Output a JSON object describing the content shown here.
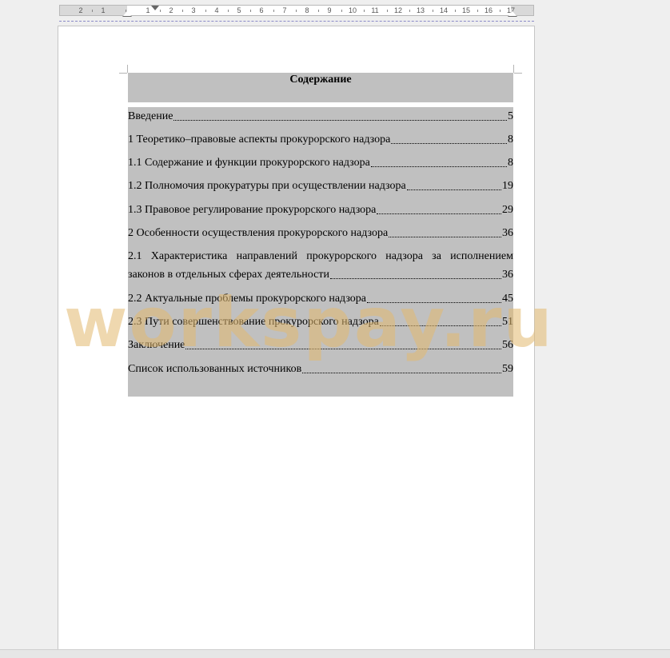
{
  "ruler": {
    "numbers": [
      "2",
      "1",
      "1",
      "2",
      "3",
      "4",
      "5",
      "6",
      "7",
      "8",
      "9",
      "10",
      "11",
      "12",
      "13",
      "14",
      "15",
      "16",
      "17"
    ]
  },
  "document": {
    "toc_title": "Содержание",
    "entries": [
      {
        "label": "Введение",
        "page": "5"
      },
      {
        "label": "1 Теоретико–правовые аспекты прокурорского надзора",
        "page": "8"
      },
      {
        "label": "1.1 Содержание и функции прокурорского надзора",
        "page": "8"
      },
      {
        "label": "1.2 Полномочия прокуратуры при осуществлении надзора",
        "page": "19"
      },
      {
        "label": "1.3 Правовое регулирование прокурорского надзора",
        "page": "29"
      },
      {
        "label": "2 Особенности осуществления прокурорского надзора",
        "page": "36"
      },
      {
        "label_line1": "2.1 Характеристика направлений прокурорского надзора за исполнением",
        "label_line2": "законов в отдельных сферах деятельности",
        "page": "36"
      },
      {
        "label": "2.2 Актуальные проблемы прокурорского надзора",
        "page": "45"
      },
      {
        "label": "2.3 Пути совершенствование прокурорского надзора",
        "page": "51"
      },
      {
        "label": "Заключение",
        "page": "56"
      },
      {
        "label": "Список использованных источников",
        "page": "59"
      }
    ]
  },
  "watermark": {
    "text": "workspay.ru"
  }
}
